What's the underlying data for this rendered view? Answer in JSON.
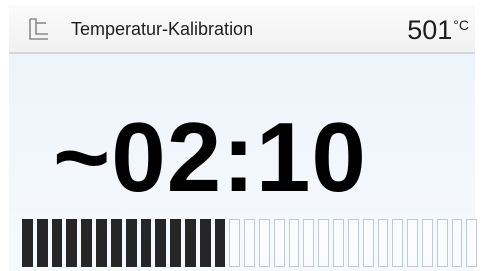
{
  "header": {
    "icon": "furnace-corner-icon",
    "title": "Temperatur-Kalibration",
    "temperature_value": "501",
    "temperature_unit": "°C"
  },
  "main": {
    "timer": "~02:10"
  },
  "progress": {
    "segments_total": 31,
    "segments_filled": 14,
    "filled_color": "#262626",
    "empty_border_color": "#c3c9d0"
  },
  "colors": {
    "header_bg": "#f5f5f5",
    "main_bg": "#f2f6fb",
    "text": "#1e1e1e"
  }
}
